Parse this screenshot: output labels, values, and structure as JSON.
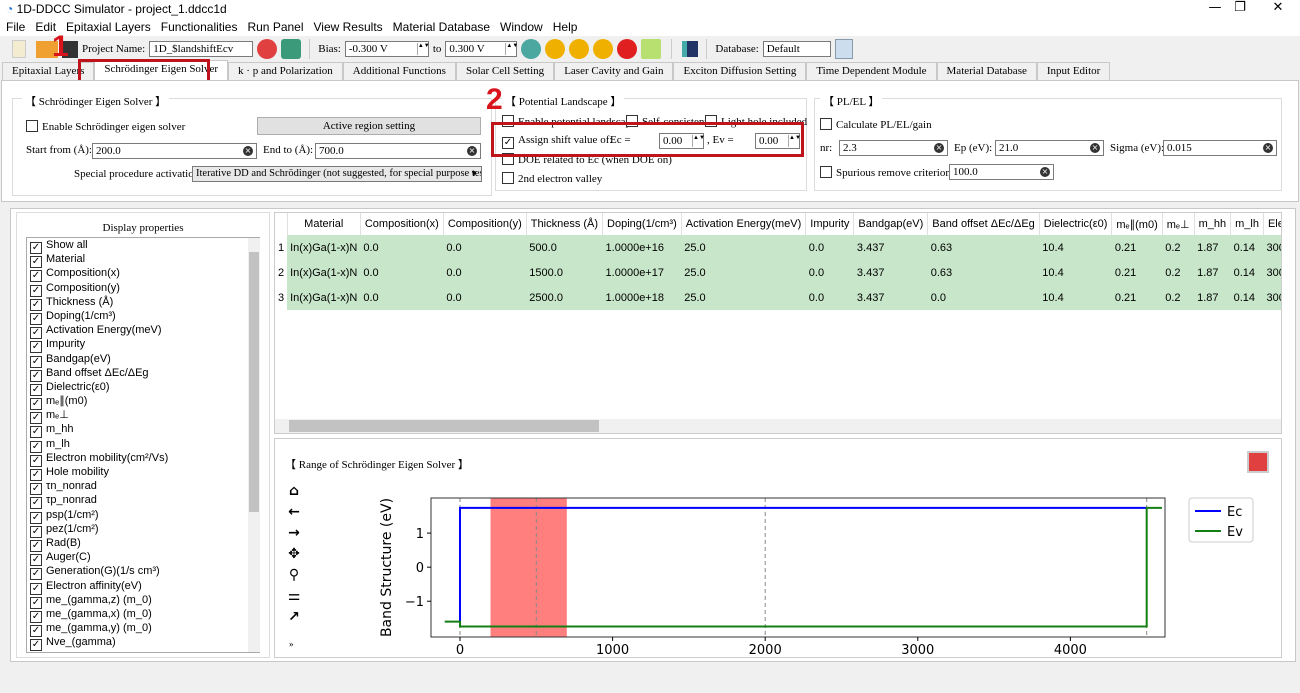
{
  "window": {
    "title": "1D-DDCC Simulator - project_1.ddcc1d",
    "controls": [
      "—",
      "❐",
      "✕"
    ]
  },
  "menu": [
    "File",
    "Edit",
    "Epitaxial Layers",
    "Functionalities",
    "Run Panel",
    "View Results",
    "Material Database",
    "Window",
    "Help"
  ],
  "toolbar": {
    "project_label": "Project Name:",
    "project_value": "1D_$landshiftEcv",
    "bias_label": "Bias:",
    "bias_from": "-0.300 V",
    "bias_to_label": "to",
    "bias_to": "0.300 V",
    "database_label": "Database:",
    "database_value": "Default"
  },
  "tabs": [
    "Epitaxial Layers",
    "Schrödinger Eigen Solver",
    "k · p and Polarization",
    "Additional Functions",
    "Solar Cell Setting",
    "Laser Cavity and Gain",
    "Exciton Diffusion Setting",
    "Time Dependent Module",
    "Material Database",
    "Input Editor"
  ],
  "active_tab": "Schrödinger Eigen Solver",
  "annotations": {
    "step1": "1",
    "step2": "2",
    "highlight_color": "#c0141c"
  },
  "schrodinger": {
    "title": "【 Schrödinger Eigen Solver 】",
    "enable_label": "Enable Schrödinger eigen solver",
    "enable_checked": false,
    "active_region_button": "Active region setting",
    "start_label": "Start from (Å):",
    "start_value": "200.0",
    "end_label": "End to (Å):",
    "end_value": "700.0",
    "special_label": "Special procedure activation:",
    "special_value": "Iterative DD and Schrödinger (not suggested, for special purpose test)"
  },
  "potential": {
    "title": "【 Potential Landscape 】",
    "enable_label": "Enable potential landscape",
    "self_consistent_label": "Self-consistent",
    "light_hole_label": "Light hole included",
    "assign_label": "Assign shift value of:",
    "assign_checked": true,
    "ec_label": "Ec =",
    "ec_value": "0.00",
    "ev_label": ", Ev =",
    "ev_value": "0.00",
    "doe_label": "DOE related to Ec (when DOE on)",
    "valley_label": "2nd electron valley"
  },
  "plel": {
    "title": "【 PL/EL 】",
    "calc_label": "Calculate PL/EL/gain",
    "nr_label": "nr:",
    "nr_value": "2.3",
    "ep_label": "Ep (eV):",
    "ep_value": "21.0",
    "sigma_label": "Sigma (eV):",
    "sigma_value": "0.015",
    "spurious_label": "Spurious remove criterion:",
    "spurious_value": "100.0"
  },
  "display": {
    "title": "Display properties",
    "items": [
      "Show all",
      "Material",
      "Composition(x)",
      "Composition(y)",
      "Thickness (Å)",
      "Doping(1/cm³)",
      "Activation Energy(meV)",
      "Impurity",
      "Bandgap(eV)",
      "Band offset ΔEc/ΔEg",
      "Dielectric(ε0)",
      "mₑ∥(m0)",
      "mₑ⊥",
      "m_hh",
      "m_lh",
      "Electron mobility(cm²/Vs)",
      "Hole mobility",
      "τn_nonrad",
      "τp_nonrad",
      "psp(1/cm²)",
      "pez(1/cm²)",
      "Rad(B)",
      "Auger(C)",
      "Generation(G)(1/s cm³)",
      "Electron affinity(eV)",
      "me_(gamma,z) (m_0)",
      "me_(gamma,x) (m_0)",
      "me_(gamma,y) (m_0)",
      "Nve_(gamma)"
    ]
  },
  "table": {
    "columns": [
      "Material",
      "Composition(x)",
      "Composition(y)",
      "Thickness (Å)",
      "Doping(1/cm³)",
      "Activation Energy(meV)",
      "Impurity",
      "Bandgap(eV)",
      "Band offset ΔEc/ΔEg",
      "Dielectric(ε0)",
      "mₑ∥(m0)",
      "mₑ⊥",
      "m_hh",
      "m_lh",
      "Electron"
    ],
    "rows": [
      [
        "1",
        "In(x)Ga(1-x)N",
        "0.0",
        "0.0",
        "500.0",
        "1.0000e+16",
        "25.0",
        "0.0",
        "3.437",
        "0.63",
        "10.4",
        "0.21",
        "0.2",
        "1.87",
        "0.14",
        "300.0"
      ],
      [
        "2",
        "In(x)Ga(1-x)N",
        "0.0",
        "0.0",
        "1500.0",
        "1.0000e+17",
        "25.0",
        "0.0",
        "3.437",
        "0.63",
        "10.4",
        "0.21",
        "0.2",
        "1.87",
        "0.14",
        "300.0"
      ],
      [
        "3",
        "In(x)Ga(1-x)N",
        "0.0",
        "0.0",
        "2500.0",
        "1.0000e+18",
        "25.0",
        "0.0",
        "3.437",
        "0.0",
        "10.4",
        "0.21",
        "0.2",
        "1.87",
        "0.14",
        "300.0"
      ]
    ],
    "row_color": "#c8e6c9"
  },
  "plot_panel": {
    "title": "【 Range of Schrödinger Eigen Solver 】",
    "tools": [
      "home-icon",
      "back-icon",
      "forward-icon",
      "pan-icon",
      "zoom-icon",
      "configure-icon",
      "edit-axis-icon"
    ]
  },
  "chart_data": {
    "type": "line",
    "ylabel": "Band Structure (eV)",
    "xlim": [
      -190,
      4620
    ],
    "ylim": [
      -2.05,
      2.03
    ],
    "xticks": [
      0,
      1000,
      2000,
      3000,
      4000
    ],
    "yticks": [
      -1,
      0,
      1
    ],
    "vlines": [
      0,
      500,
      2000,
      4500
    ],
    "highlight_span": {
      "x": [
        200,
        700
      ],
      "color": "#ff7f7f"
    },
    "legend": "outside-right",
    "series": [
      {
        "name": "Ec",
        "color": "#0000ff",
        "x": [
          0,
          0,
          4500
        ],
        "y": [
          -1.6,
          1.74,
          1.74
        ]
      },
      {
        "name": "Ev",
        "color": "#137f13",
        "x": [
          -100,
          0,
          0,
          4500,
          4500,
          4600
        ],
        "y": [
          -1.6,
          -1.6,
          -1.74,
          -1.74,
          1.74,
          1.74
        ]
      }
    ]
  }
}
